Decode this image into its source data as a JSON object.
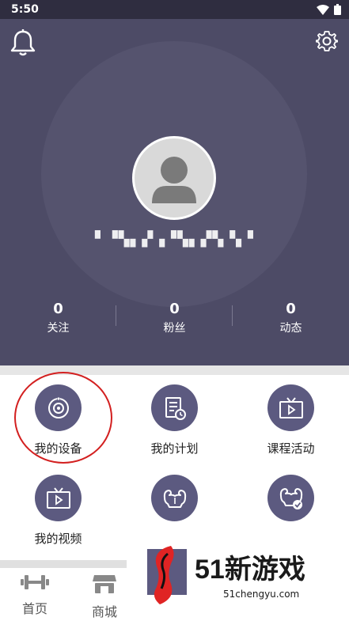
{
  "status_bar": {
    "time": "5:50"
  },
  "profile": {
    "username": "▘▝▚▖▞▗▝▚▖▞▚▝▖▘",
    "stats": [
      {
        "value": "0",
        "label": "关注"
      },
      {
        "value": "0",
        "label": "粉丝"
      },
      {
        "value": "0",
        "label": "动态"
      }
    ]
  },
  "features": [
    {
      "label": "我的设备",
      "icon": "device-wifi-icon"
    },
    {
      "label": "我的计划",
      "icon": "plan-document-icon"
    },
    {
      "label": "课程活动",
      "icon": "tv-play-icon"
    },
    {
      "label": "我的视频",
      "icon": "tv-play-icon"
    },
    {
      "label": "",
      "icon": "muscle-icon"
    },
    {
      "label": "",
      "icon": "muscle-check-icon"
    }
  ],
  "tabs": [
    {
      "label": "首页",
      "icon": "dumbbell-icon"
    },
    {
      "label": "商城",
      "icon": "store-icon"
    }
  ],
  "watermark": {
    "title": "51新游戏",
    "subtitle": "51chengyu.com"
  },
  "colors": {
    "header_bg": "#4d4b66",
    "icon_bg": "#5c5a80",
    "highlight": "#d32020"
  }
}
